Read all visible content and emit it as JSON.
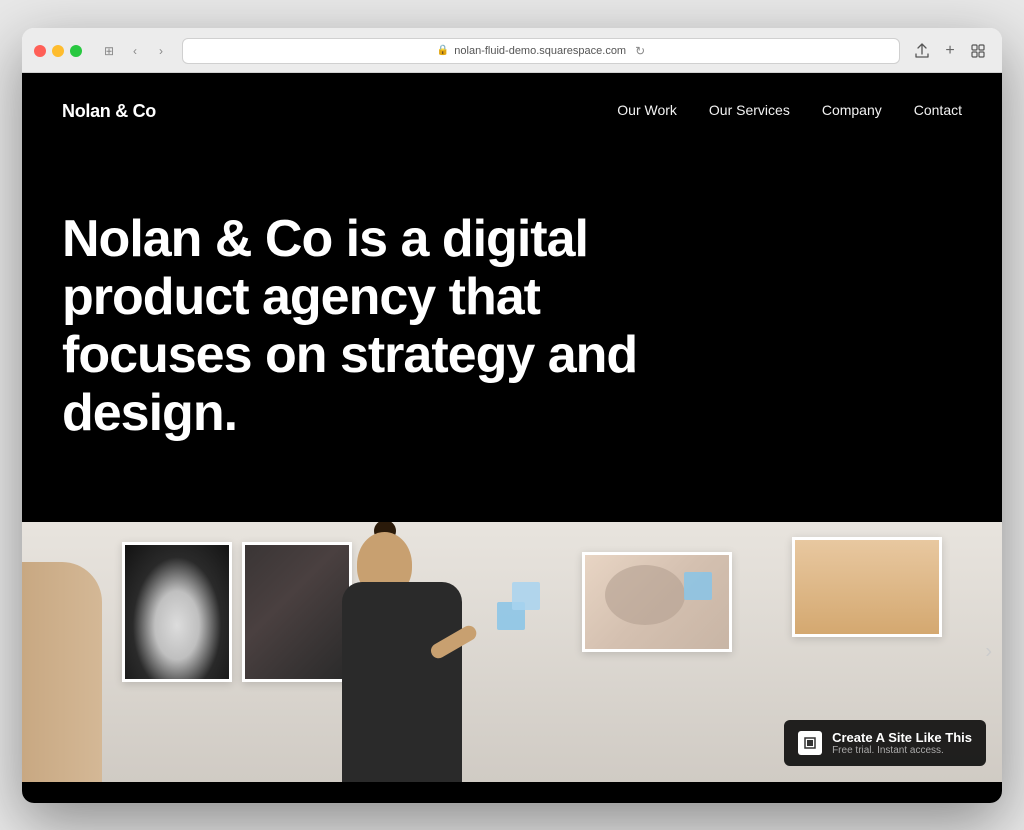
{
  "browser": {
    "url": "nolan-fluid-demo.squarespace.com",
    "tab_icon": "🔒"
  },
  "site": {
    "logo": "Nolan & Co",
    "nav": {
      "links": [
        {
          "label": "Our Work",
          "href": "#"
        },
        {
          "label": "Our Services",
          "href": "#"
        },
        {
          "label": "Company",
          "href": "#"
        },
        {
          "label": "Contact",
          "href": "#"
        }
      ]
    },
    "hero": {
      "headline": "Nolan & Co is a digital product agency that focuses on strategy and design."
    },
    "badge": {
      "title": "Create A Site Like This",
      "subtitle": "Free trial. Instant access."
    }
  }
}
